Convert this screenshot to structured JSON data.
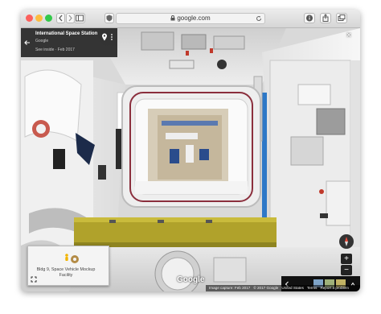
{
  "browser": {
    "url": "google.com",
    "lock_icon": "lock-icon",
    "colors": {
      "close": "#fc605c",
      "minimize": "#fdbc40",
      "zoom": "#34c84a"
    }
  },
  "infobox": {
    "title": "International Space Station",
    "subtitle": "Google",
    "date_text": "See inside · Feb 2017"
  },
  "minimap": {
    "label": "Bldg 9, Space Vehicle Mockup Facility"
  },
  "watermark": "Google",
  "footer": {
    "capture": "Image capture: Feb 2017",
    "copyright": "© 2017 Google",
    "country": "United States",
    "terms": "Terms",
    "report": "Report a problem"
  },
  "controls": {
    "zoom_in": "+",
    "zoom_out": "−",
    "close": "×"
  }
}
